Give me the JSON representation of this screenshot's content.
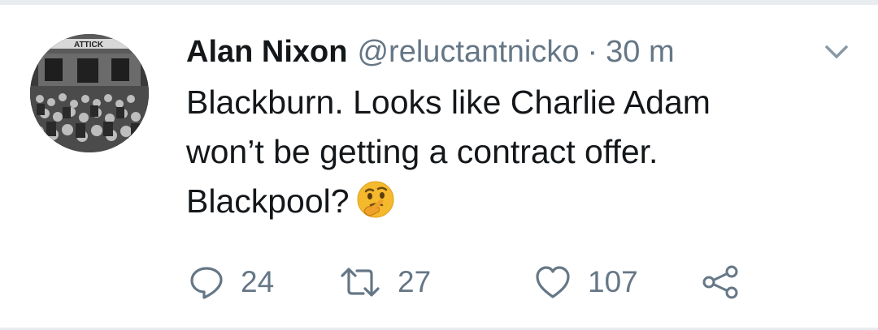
{
  "tweet": {
    "author": {
      "display_name": "Alan Nixon",
      "handle": "@reluctantnicko",
      "avatar_text": "ATTICK"
    },
    "separator": "·",
    "timestamp": "30 m",
    "text_lines": [
      "Blackburn. Looks like Charlie Adam",
      "won’t be getting a contract offer.",
      "Blackpool?"
    ],
    "emoji": "thinking-face-icon",
    "actions": {
      "replies": "24",
      "retweets": "27",
      "likes": "107"
    }
  },
  "icons": {
    "menu": "chevron-down-icon",
    "reply": "reply-icon",
    "retweet": "retweet-icon",
    "like": "heart-icon",
    "share": "share-icon"
  },
  "colors": {
    "text": "#14171a",
    "secondary": "#657786",
    "divider": "#e6ecf0",
    "emoji": "#f5b92e"
  }
}
